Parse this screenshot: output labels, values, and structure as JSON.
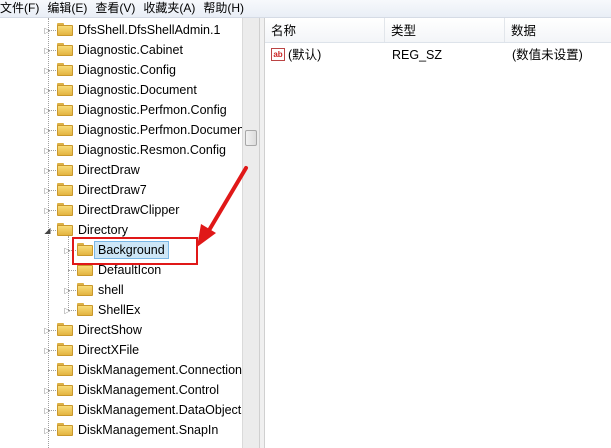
{
  "menu": [
    "文件(F)",
    "编辑(E)",
    "查看(V)",
    "收藏夹(A)",
    "帮助(H)"
  ],
  "tree": {
    "items": [
      {
        "label": "DfsShell.DfsShellAdmin.1",
        "level": 0,
        "expander": "collapsed"
      },
      {
        "label": "Diagnostic.Cabinet",
        "level": 0,
        "expander": "collapsed"
      },
      {
        "label": "Diagnostic.Config",
        "level": 0,
        "expander": "collapsed"
      },
      {
        "label": "Diagnostic.Document",
        "level": 0,
        "expander": "collapsed"
      },
      {
        "label": "Diagnostic.Perfmon.Config",
        "level": 0,
        "expander": "collapsed"
      },
      {
        "label": "Diagnostic.Perfmon.Document",
        "level": 0,
        "expander": "collapsed"
      },
      {
        "label": "Diagnostic.Resmon.Config",
        "level": 0,
        "expander": "collapsed"
      },
      {
        "label": "DirectDraw",
        "level": 0,
        "expander": "collapsed"
      },
      {
        "label": "DirectDraw7",
        "level": 0,
        "expander": "collapsed"
      },
      {
        "label": "DirectDrawClipper",
        "level": 0,
        "expander": "collapsed"
      },
      {
        "label": "Directory",
        "level": 0,
        "expander": "expanded"
      },
      {
        "label": "Background",
        "level": 1,
        "expander": "collapsed",
        "selected": true
      },
      {
        "label": "DefaultIcon",
        "level": 1,
        "expander": "none"
      },
      {
        "label": "shell",
        "level": 1,
        "expander": "collapsed"
      },
      {
        "label": "ShellEx",
        "level": 1,
        "expander": "collapsed"
      },
      {
        "label": "DirectShow",
        "level": 0,
        "expander": "collapsed"
      },
      {
        "label": "DirectXFile",
        "level": 0,
        "expander": "collapsed"
      },
      {
        "label": "DiskManagement.Connection",
        "level": 0,
        "expander": "none"
      },
      {
        "label": "DiskManagement.Control",
        "level": 0,
        "expander": "collapsed"
      },
      {
        "label": "DiskManagement.DataObject",
        "level": 0,
        "expander": "collapsed"
      },
      {
        "label": "DiskManagement.SnapIn",
        "level": 0,
        "expander": "collapsed"
      }
    ]
  },
  "list": {
    "columns": [
      "名称",
      "类型",
      "数据"
    ],
    "rows": [
      {
        "icon": "string-value-icon",
        "icon_text": "ab",
        "name": "(默认)",
        "type": "REG_SZ",
        "data": "(数值未设置)"
      }
    ]
  },
  "colors": {
    "annotation": "#e01818",
    "selection": "#cde6f7"
  }
}
